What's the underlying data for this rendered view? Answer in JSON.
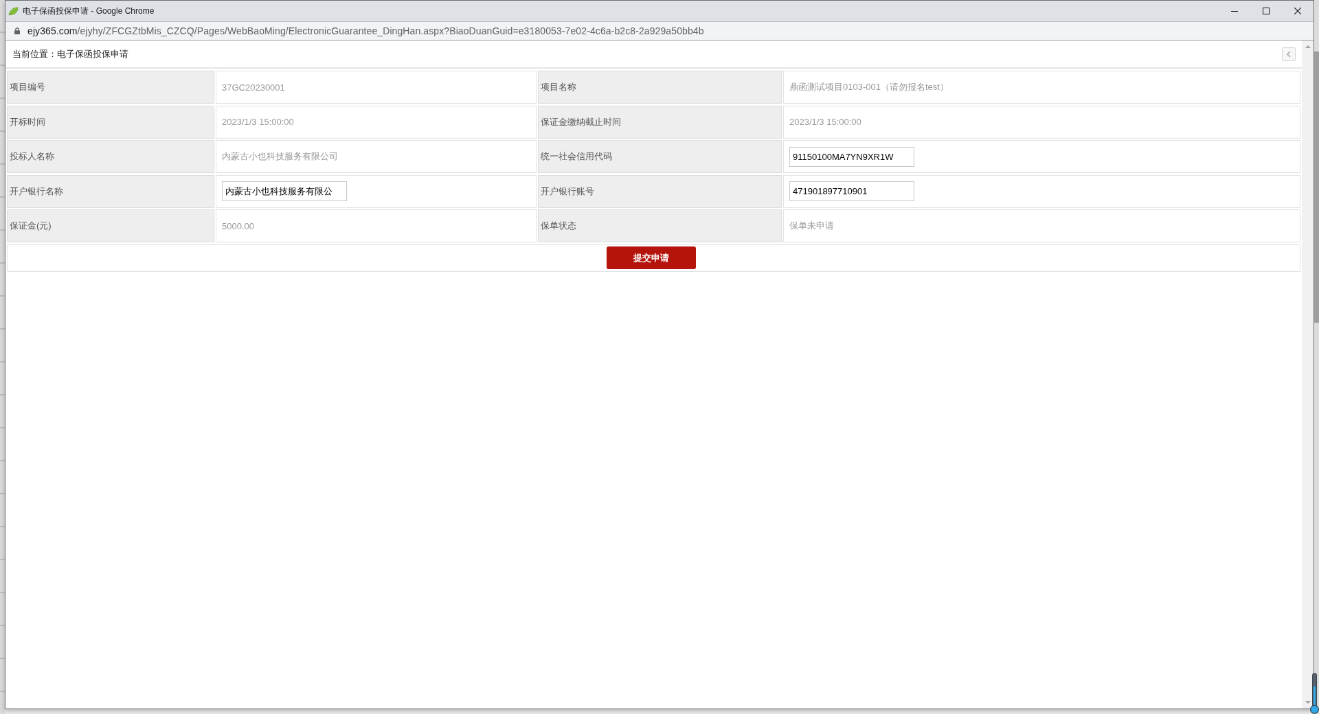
{
  "window": {
    "title": "电子保函投保申请 - Google Chrome"
  },
  "address_bar": {
    "host": "ejy365.com",
    "path": "/ejyhy/ZFCGZtbMis_CZCQ/Pages/WebBaoMing/ElectronicGuarantee_DingHan.aspx?BiaoDuanGuid=e3180053-7e02-4c6a-b2c8-2a929a50bb4b"
  },
  "breadcrumb": "当前位置：电子保函投保申请",
  "form": {
    "rows": [
      {
        "fields": [
          {
            "label": "项目编号",
            "kind": "text",
            "value": "37GC20230001"
          },
          {
            "label": "项目名称",
            "kind": "text",
            "value": "鼎函测试项目0103-001（请勿报名test）"
          }
        ]
      },
      {
        "fields": [
          {
            "label": "开标时间",
            "kind": "text",
            "value": "2023/1/3 15:00:00"
          },
          {
            "label": "保证金缴纳截止时间",
            "kind": "text",
            "value": "2023/1/3 15:00:00"
          }
        ]
      },
      {
        "fields": [
          {
            "label": "投标人名称",
            "kind": "text",
            "value": "内蒙古小也科技服务有限公司"
          },
          {
            "label": "统一社会信用代码",
            "kind": "input",
            "value": "91150100MA7YN9XR1W"
          }
        ]
      },
      {
        "fields": [
          {
            "label": "开户银行名称",
            "kind": "input",
            "value": "内蒙古小也科技服务有限公"
          },
          {
            "label": "开户银行账号",
            "kind": "input",
            "value": "471901897710901"
          }
        ]
      },
      {
        "fields": [
          {
            "label": "保证金(元)",
            "kind": "text",
            "value": "5000.00"
          },
          {
            "label": "保单状态",
            "kind": "text",
            "value": "保单未申请"
          }
        ]
      }
    ],
    "submit_button": "提交申请"
  }
}
